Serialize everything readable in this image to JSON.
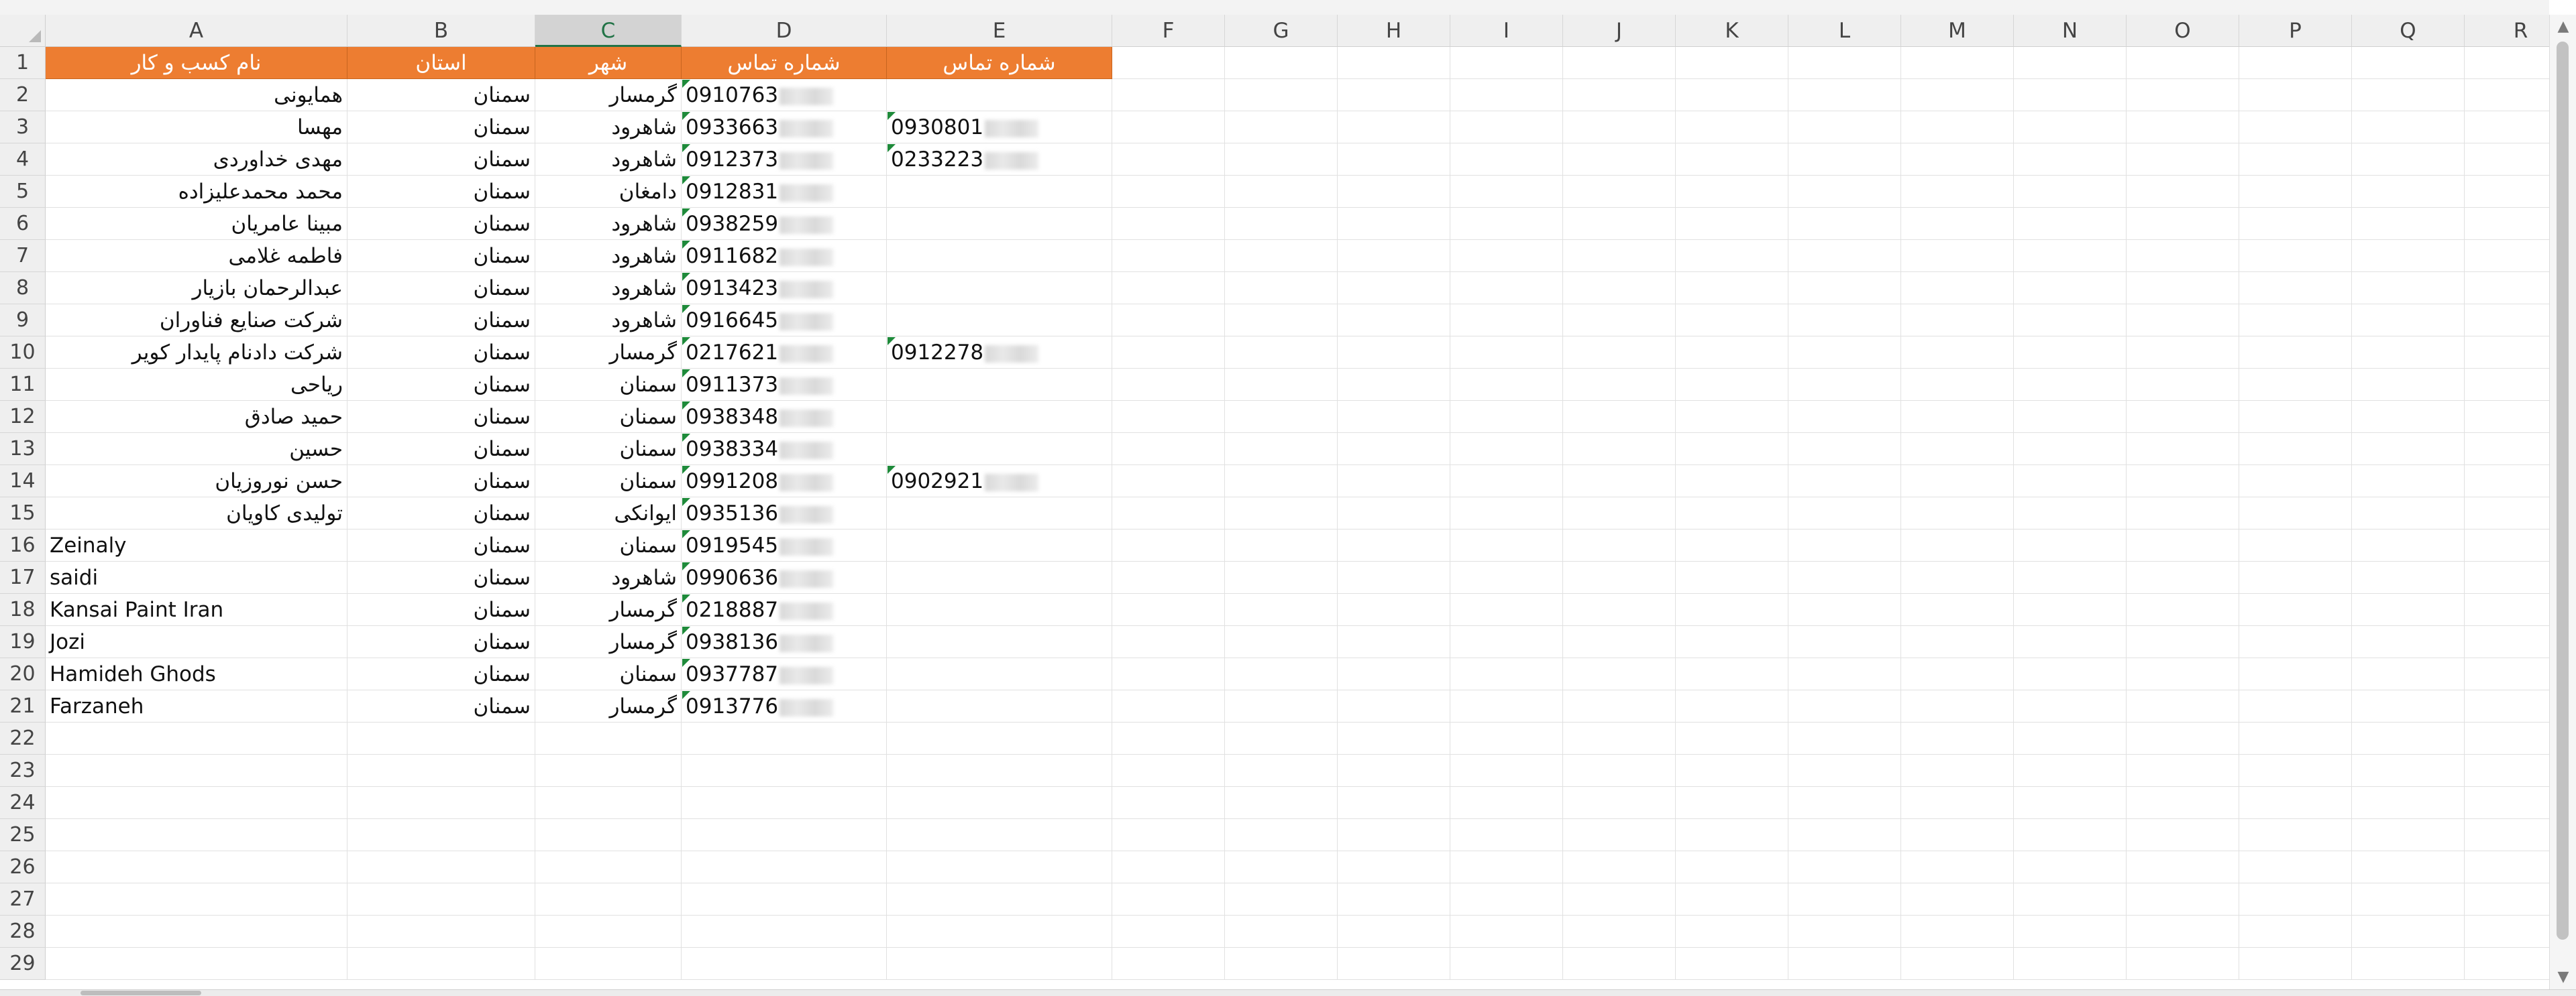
{
  "columns": [
    "A",
    "B",
    "C",
    "D",
    "E",
    "F",
    "G",
    "H",
    "I",
    "J",
    "K",
    "L",
    "M",
    "N",
    "O",
    "P",
    "Q",
    "R"
  ],
  "selected_column": "C",
  "row_numbers": [
    "1",
    "2",
    "3",
    "4",
    "5",
    "6",
    "7",
    "8",
    "9",
    "10",
    "11",
    "12",
    "13",
    "14",
    "15",
    "16",
    "17",
    "18",
    "19",
    "20",
    "21",
    "22",
    "23",
    "24",
    "25",
    "26",
    "27",
    "28",
    "29"
  ],
  "headers": {
    "A": "نام کسب و کار",
    "B": "استان",
    "C": "شهر",
    "D": "شماره تماس",
    "E": "شماره تماس"
  },
  "rows": [
    {
      "name": "همایونی",
      "province": "سمنان",
      "city": "گرمسار",
      "phone1": "0910763",
      "phone2": ""
    },
    {
      "name": "مهسا",
      "province": "سمنان",
      "city": "شاهرود",
      "phone1": "0933663",
      "phone2": "0930801"
    },
    {
      "name": "مهدی خداوردی",
      "province": "سمنان",
      "city": "شاهرود",
      "phone1": "0912373",
      "phone2": "0233223"
    },
    {
      "name": "محمد محمدعلیزاده",
      "province": "سمنان",
      "city": "دامغان",
      "phone1": "0912831",
      "phone2": ""
    },
    {
      "name": "مبینا عامریان",
      "province": "سمنان",
      "city": "شاهرود",
      "phone1": "0938259",
      "phone2": ""
    },
    {
      "name": "فاطمه غلامی",
      "province": "سمنان",
      "city": "شاهرود",
      "phone1": "0911682",
      "phone2": ""
    },
    {
      "name": "عبدالرحمان بازیار",
      "province": "سمنان",
      "city": "شاهرود",
      "phone1": "0913423",
      "phone2": ""
    },
    {
      "name": "شرکت صنایع فناوران",
      "province": "سمنان",
      "city": "شاهرود",
      "phone1": "0916645",
      "phone2": ""
    },
    {
      "name": "شرکت دادنام پایدار کویر",
      "province": "سمنان",
      "city": "گرمسار",
      "phone1": "0217621",
      "phone2": "0912278"
    },
    {
      "name": "ریاحی",
      "province": "سمنان",
      "city": "سمنان",
      "phone1": "0911373",
      "phone2": ""
    },
    {
      "name": "حمید صادق",
      "province": "سمنان",
      "city": "سمنان",
      "phone1": "0938348",
      "phone2": ""
    },
    {
      "name": "حسین",
      "province": "سمنان",
      "city": "سمنان",
      "phone1": "0938334",
      "phone2": ""
    },
    {
      "name": "حسن نوروزیان",
      "province": "سمنان",
      "city": "سمنان",
      "phone1": "0991208",
      "phone2": "0902921"
    },
    {
      "name": "تولیدی کاویان",
      "province": "سمنان",
      "city": "ایوانکی",
      "phone1": "0935136",
      "phone2": ""
    },
    {
      "name": "Zeinaly",
      "province": "سمنان",
      "city": "سمنان",
      "phone1": "0919545",
      "phone2": ""
    },
    {
      "name": "saidi",
      "province": "سمنان",
      "city": "شاهرود",
      "phone1": "0990636",
      "phone2": ""
    },
    {
      "name": "Kansai Paint Iran",
      "province": "سمنان",
      "city": "گرمسار",
      "phone1": "0218887",
      "phone2": ""
    },
    {
      "name": "Jozi",
      "province": "سمنان",
      "city": "گرمسار",
      "phone1": "0938136",
      "phone2": ""
    },
    {
      "name": "Hamideh Ghods",
      "province": "سمنان",
      "city": "سمنان",
      "phone1": "0937787",
      "phone2": ""
    },
    {
      "name": "Farzaneh",
      "province": "سمنان",
      "city": "گرمسار",
      "phone1": "0913776",
      "phone2": ""
    }
  ],
  "colors": {
    "header_fill": "#ed7d31",
    "header_text": "#ffffff",
    "selected_column_accent": "#217346",
    "text_number_indicator": "#1e8a3a"
  },
  "icons": [
    "text-number-warning-icon",
    "select-all-icon",
    "scroll-up-arrow-icon",
    "scroll-down-arrow-icon"
  ]
}
